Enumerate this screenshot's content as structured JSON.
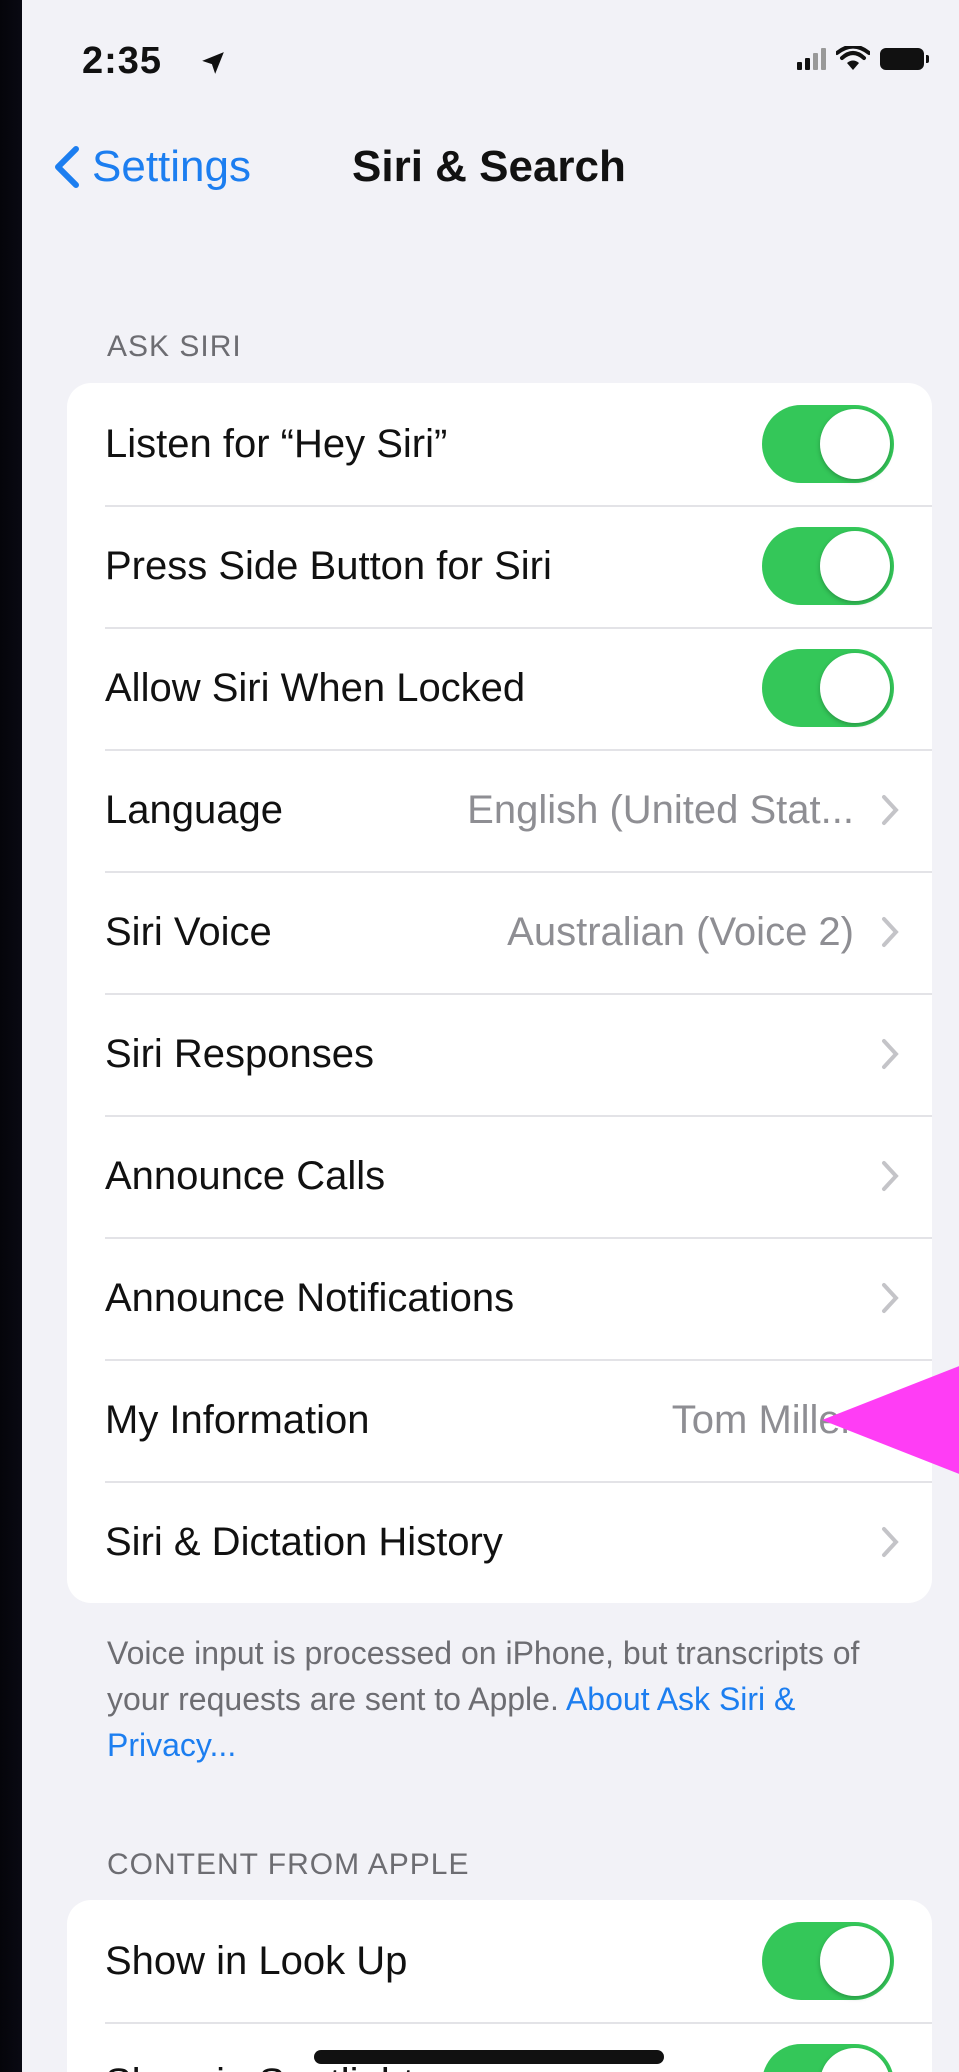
{
  "status": {
    "time": "2:35"
  },
  "nav": {
    "back_label": "Settings",
    "title": "Siri & Search"
  },
  "ask_siri": {
    "header": "ASK SIRI",
    "rows": [
      {
        "label": "Listen for “Hey Siri”",
        "type": "toggle",
        "on": true
      },
      {
        "label": "Press Side Button for Siri",
        "type": "toggle",
        "on": true
      },
      {
        "label": "Allow Siri When Locked",
        "type": "toggle",
        "on": true
      },
      {
        "label": "Language",
        "value": "English (United Stat...",
        "type": "link"
      },
      {
        "label": "Siri Voice",
        "value": "Australian (Voice 2)",
        "type": "link"
      },
      {
        "label": "Siri Responses",
        "type": "link"
      },
      {
        "label": "Announce Calls",
        "type": "link"
      },
      {
        "label": "Announce Notifications",
        "type": "link"
      },
      {
        "label": "My Information",
        "value": "Tom Miller",
        "type": "link"
      },
      {
        "label": "Siri & Dictation History",
        "type": "link"
      }
    ],
    "footer_text": "Voice input is processed on iPhone, but transcripts of your requests are sent to Apple.",
    "footer_link": "About Ask Siri & Privacy..."
  },
  "content_from_apple": {
    "header": "CONTENT FROM APPLE",
    "rows": [
      {
        "label": "Show in Look Up",
        "type": "toggle",
        "on": true
      },
      {
        "label": "Show in Spotlight",
        "type": "toggle",
        "on": true
      }
    ]
  },
  "colors": {
    "accent": "#1c7ef0",
    "toggle_on": "#34c759",
    "annotation_arrow": "#ff3df5"
  },
  "annotation": {
    "icon": "pink-pointer-arrow-icon"
  }
}
